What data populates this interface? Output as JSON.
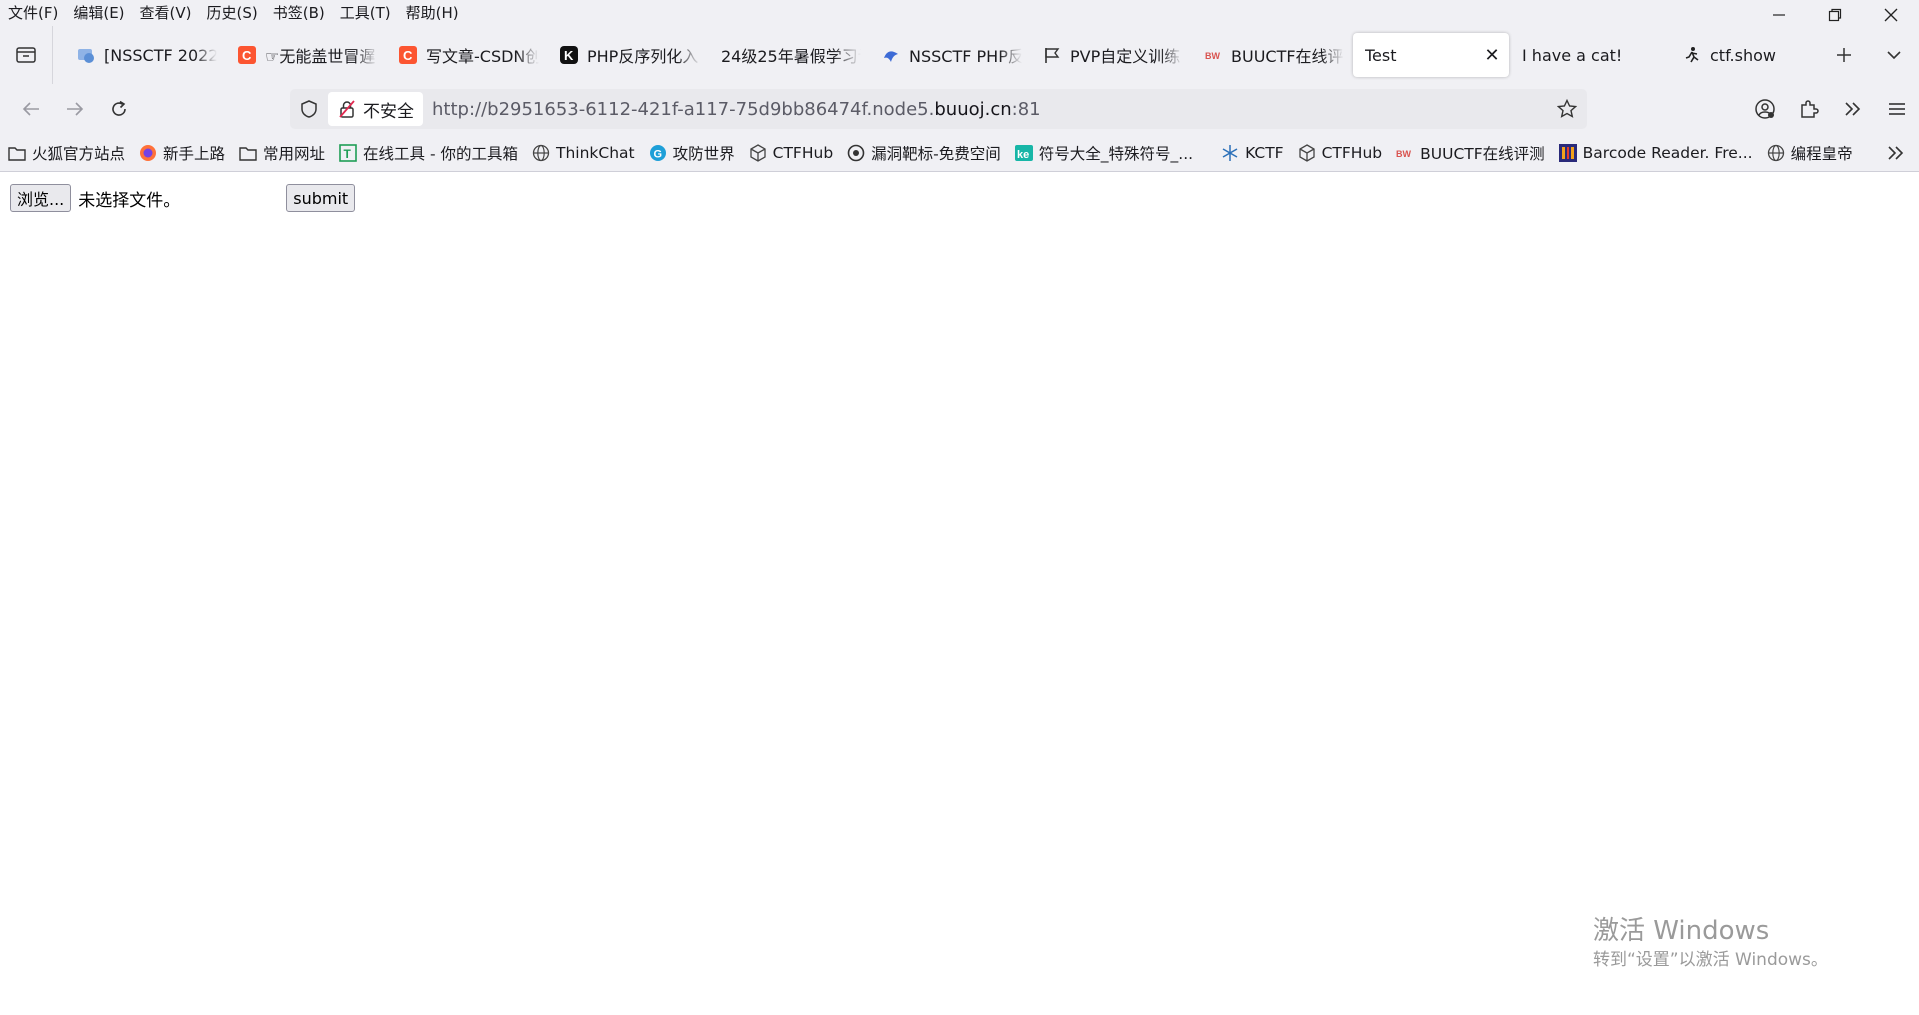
{
  "menu": [
    "文件(F)",
    "编辑(E)",
    "查看(V)",
    "历史(S)",
    "书签(B)",
    "工具(T)",
    "帮助(H)"
  ],
  "tabs": [
    {
      "title": "[NSSCTF 2022",
      "icon": "globe-icon",
      "color": "#5b8fd6"
    },
    {
      "title": "☞无能盖世冒遅",
      "icon": "csdn-icon",
      "color": "#fc5531"
    },
    {
      "title": "写文章-CSDN创",
      "icon": "csdn-icon",
      "color": "#fc5531"
    },
    {
      "title": "PHP反序列化入",
      "icon": "k-icon",
      "color": "#111111"
    },
    {
      "title": "24级25年暑假学习计",
      "icon": "none",
      "color": ""
    },
    {
      "title": "NSSCTF PHP反",
      "icon": "nssctf-icon",
      "color": "#3d6bd6"
    },
    {
      "title": "PVP自定义训练",
      "icon": "flag-icon",
      "color": "#333333"
    },
    {
      "title": "BUUCTF在线评",
      "icon": "buu-icon",
      "color": "#d9534f"
    },
    {
      "title": "Test",
      "icon": "none",
      "color": "",
      "active": true
    },
    {
      "title": "I have a cat!",
      "icon": "none",
      "color": ""
    },
    {
      "title": "ctf.show",
      "icon": "runner-icon",
      "color": "#222222"
    }
  ],
  "nav": {
    "insecure_label": "不安全",
    "url_prefix": "http://b2951653-6112-421f-a117-75d9bb86474f.node5.",
    "url_domain": "buuoj.cn",
    "url_suffix": ":81"
  },
  "bookmarks": [
    {
      "label": "火狐官方站点",
      "icon": "folder-icon"
    },
    {
      "label": "新手上路",
      "icon": "firefox-icon"
    },
    {
      "label": "常用网址",
      "icon": "folder-icon"
    },
    {
      "label": "在线工具 - 你的工具箱",
      "icon": "tool-icon"
    },
    {
      "label": "ThinkChat",
      "icon": "globe-icon"
    },
    {
      "label": "攻防世界",
      "icon": "adworld-icon"
    },
    {
      "label": "CTFHub",
      "icon": "cube-icon"
    },
    {
      "label": "漏洞靶标-免费空间",
      "icon": "vuln-icon"
    },
    {
      "label": "符号大全_特殊符号_...",
      "icon": "ke-icon"
    },
    {
      "label": "KCTF",
      "icon": "snowflake-icon"
    },
    {
      "label": "CTFHub",
      "icon": "cube-icon"
    },
    {
      "label": "BUUCTF在线评测",
      "icon": "buu-icon"
    },
    {
      "label": "Barcode Reader. Fre...",
      "icon": "barcode-icon"
    },
    {
      "label": "编程皇帝",
      "icon": "globe-icon"
    }
  ],
  "page": {
    "browse_label": "浏览...",
    "no_file_label": "未选择文件。",
    "submit_label": "submit"
  },
  "watermark": {
    "line1": "激活 Windows",
    "line2": "转到“设置”以激活 Windows。"
  }
}
